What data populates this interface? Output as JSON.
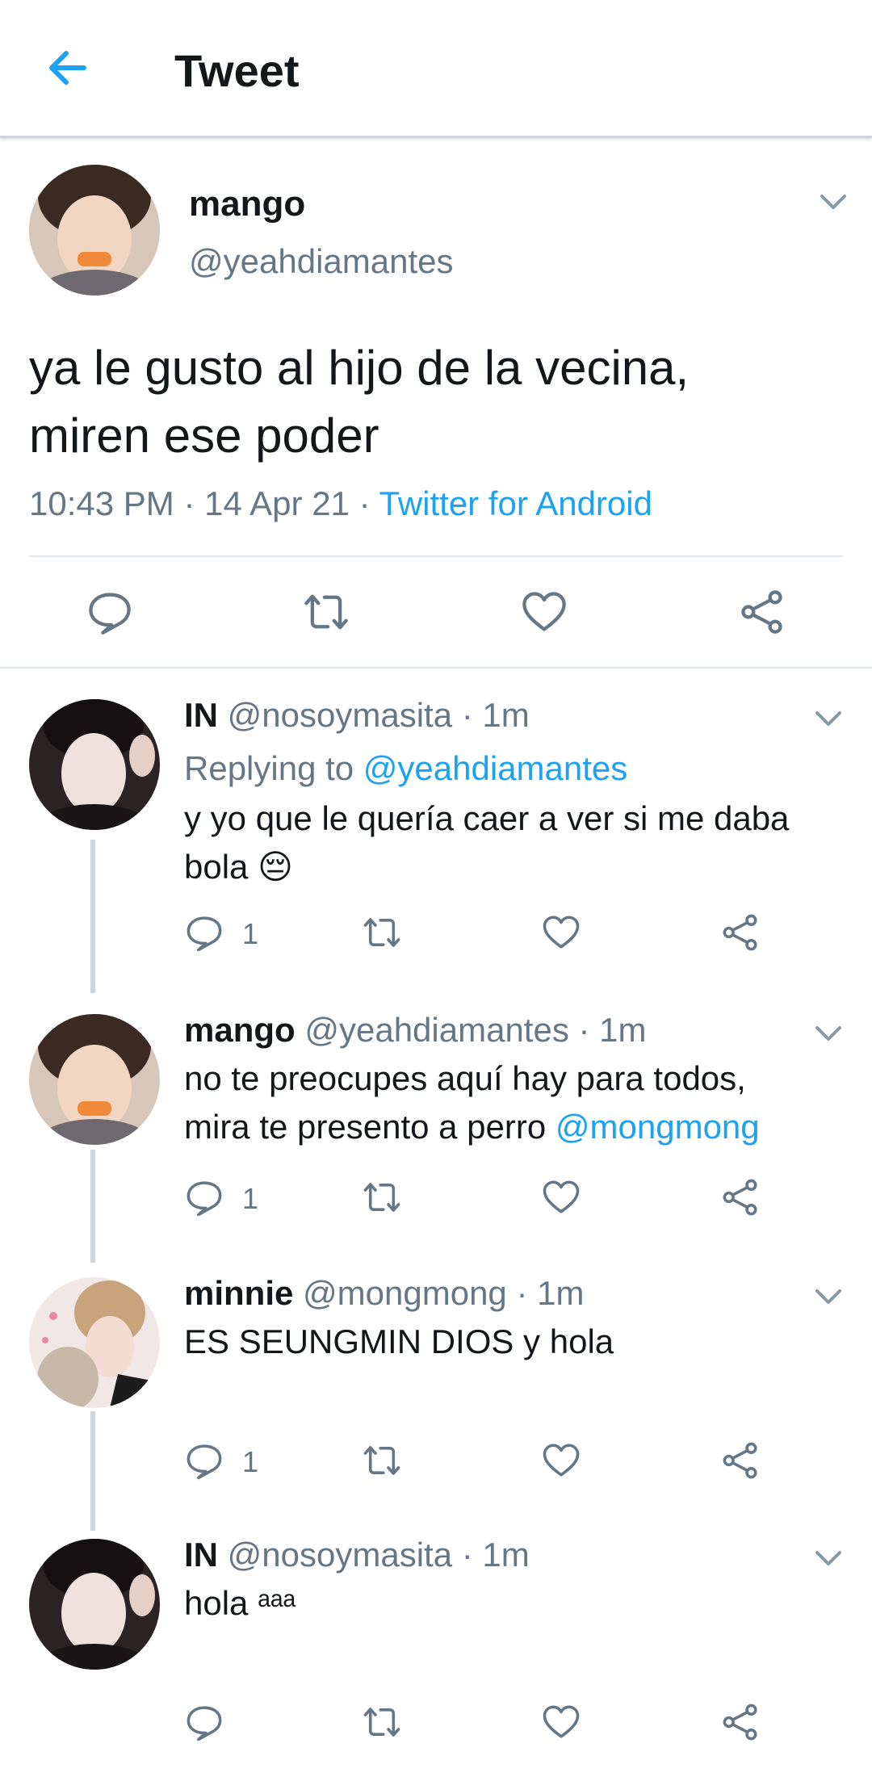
{
  "header": {
    "title": "Tweet"
  },
  "main_tweet": {
    "name": "mango",
    "handle": "@yeahdiamantes",
    "text_line1": "ya le gusto al hijo de la vecina,",
    "text_line2": "miren ese poder",
    "timestamp": "10:43 PM · 14 Apr 21 · ",
    "source": "Twitter for Android"
  },
  "replies": [
    {
      "name": "IN",
      "handle": "@nosoymasita · 1m",
      "replying_label": "Replying to ",
      "replying_to": "@yeahdiamantes",
      "text_line1": "y yo que le quería caer a ver si me daba",
      "text_line2": "bola 😔",
      "reply_count": "1"
    },
    {
      "name": "mango",
      "handle": "@yeahdiamantes · 1m",
      "text_line1": "no te preocupes aquí hay para todos,",
      "text_line2_prefix": "mira te presento a perro ",
      "text_line2_mention": "@mongmong",
      "reply_count": "1"
    },
    {
      "name": "minnie",
      "handle": "@mongmong · 1m",
      "text_line1": "ES SEUNGMIN DIOS y hola",
      "reply_count": "1"
    },
    {
      "name": "IN",
      "handle": "@nosoymasita · 1m",
      "text_line1": "hola ᵃᵃᵃ"
    }
  ],
  "colors": {
    "accent": "#1da1f2",
    "secondary_text": "#657786",
    "icon": "#657786"
  }
}
